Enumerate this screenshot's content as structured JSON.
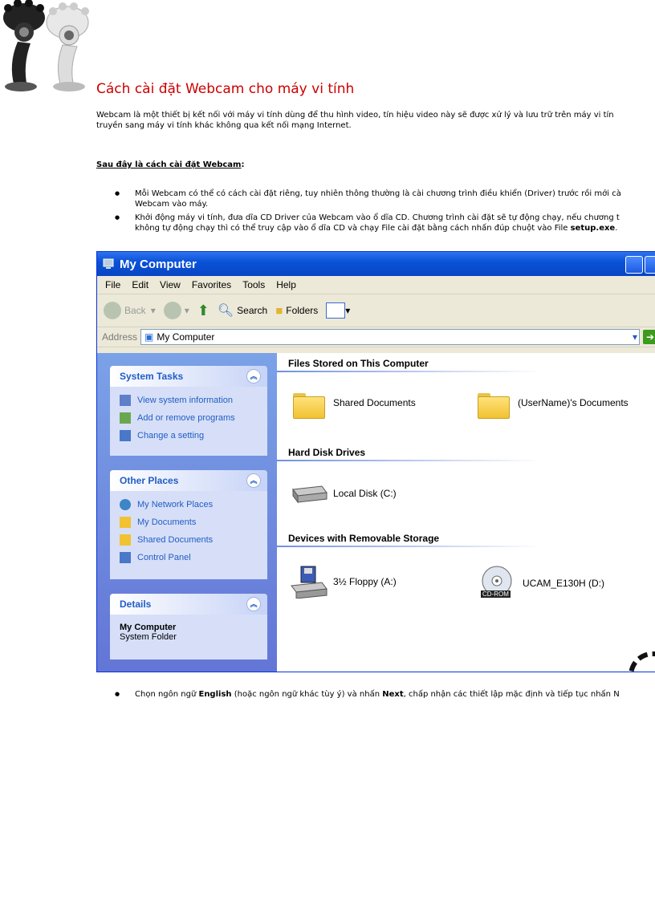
{
  "page": {
    "title": "Cách cài đặt Webcam cho máy vi tính",
    "intro_lines": [
      "Webcam là một thiết bị kết nối với máy vi tính dùng để thu hình video, tín hiệu video này sẽ được xử lý và lưu trữ trên máy vi tín",
      "truyền sang máy vi tính khác không qua kết nối mạng Internet."
    ],
    "section_heading": "Sau đây là cách cài đặt Webcam",
    "section_heading_colon": ":",
    "bullet1_lines": [
      "Mỗi Webcam có thể có cách cài đặt riêng, tuy nhiên thông thường là cài chương trình điều khiển (Driver) trước rồi mới cà",
      "Webcam vào máy."
    ],
    "bullet2_line1": "Khởi động máy vi tính, đưa dĩa CD Driver của Webcam vào ổ dĩa CD. Chương trình cài đặt sẽ tự động chạy, nếu chương t",
    "bullet2_line2_pre": "không tự động chạy thì có thể truy cập vào ổ dĩa CD và chạy File cài đặt bằng cách nhấn đúp chuột vào File ",
    "bullet2_line2_bold": "setup.exe",
    "bullet2_line2_post": ".",
    "bullet3_pre": "Chọn ngôn ngữ ",
    "bullet3_bold1": "English",
    "bullet3_mid": " (hoặc ngôn ngữ khác tùy ý) và nhấn ",
    "bullet3_bold2": "Next",
    "bullet3_post": ", chấp nhận các thiết lập mặc định và tiếp tục nhấn N"
  },
  "window": {
    "title": "My Computer",
    "menu": [
      "File",
      "Edit",
      "View",
      "Favorites",
      "Tools",
      "Help"
    ],
    "toolbar": {
      "back": "Back",
      "search": "Search",
      "folders": "Folders"
    },
    "address_label": "Address",
    "address_value": "My Computer",
    "system_tasks": {
      "title": "System Tasks",
      "items": [
        "View system information",
        "Add or remove programs",
        "Change a setting"
      ]
    },
    "other_places": {
      "title": "Other Places",
      "items": [
        "My Network Places",
        "My Documents",
        "Shared Documents",
        "Control Panel"
      ]
    },
    "details": {
      "title": "Details",
      "name": "My Computer",
      "type": "System Folder"
    },
    "files_section": "Files Stored on This Computer",
    "shared_docs": "Shared Documents",
    "user_docs": "(UserName)'s Documents",
    "hdd_section": "Hard Disk Drives",
    "local_disk": "Local Disk (C:)",
    "removable_section": "Devices with Removable Storage",
    "floppy": "3½ Floppy (A:)",
    "cdrom": "UCAM_E130H (D:)",
    "cdrom_badge": "CD-ROM"
  },
  "colors": {
    "title_red": "#cc0000",
    "xp_blue": "#0a52d8",
    "link_blue": "#215dc6"
  }
}
